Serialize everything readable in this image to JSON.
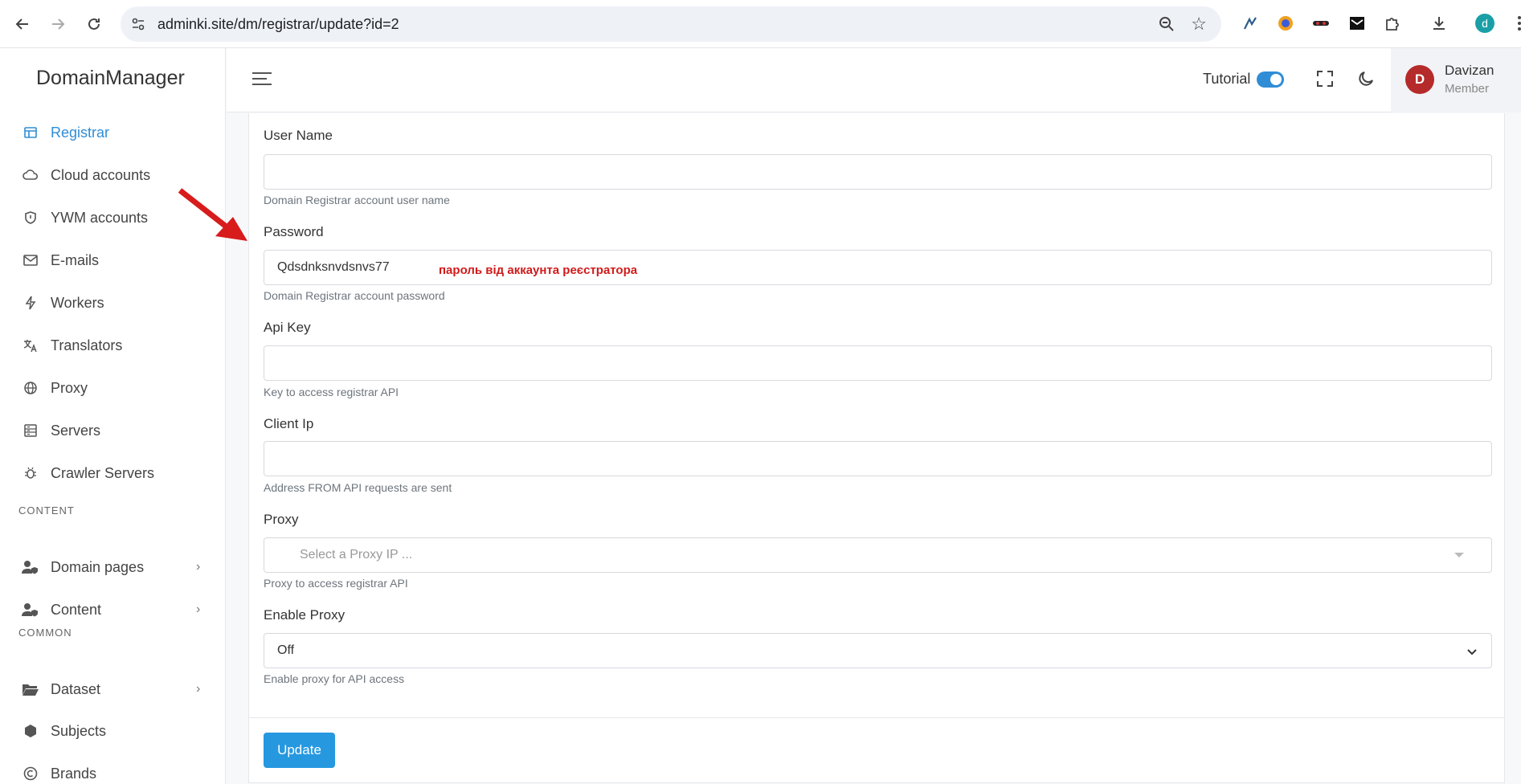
{
  "browser": {
    "url": "adminki.site/dm/registrar/update?id=2",
    "profile_initial": "d"
  },
  "sidebar": {
    "brand": "DomainManager",
    "items": [
      {
        "label": "Registrar",
        "icon": "window-icon"
      },
      {
        "label": "Cloud accounts",
        "icon": "cloud-icon"
      },
      {
        "label": "YWM accounts",
        "icon": "shield-icon"
      },
      {
        "label": "E-mails",
        "icon": "mail-icon"
      },
      {
        "label": "Workers",
        "icon": "bolt-icon"
      },
      {
        "label": "Translators",
        "icon": "translate-icon"
      },
      {
        "label": "Proxy",
        "icon": "globe-icon"
      },
      {
        "label": "Servers",
        "icon": "server-icon"
      },
      {
        "label": "Crawler Servers",
        "icon": "bug-icon"
      }
    ],
    "section_content": "CONTENT",
    "content_items": [
      {
        "label": "Domain pages",
        "icon": "user-shield-icon"
      },
      {
        "label": "Content",
        "icon": "user-shield-icon"
      }
    ],
    "section_common": "COMMON",
    "common_items": [
      {
        "label": "Dataset",
        "icon": "folder-icon"
      },
      {
        "label": "Subjects",
        "icon": "hexagon-icon"
      },
      {
        "label": "Brands",
        "icon": "copyright-icon"
      }
    ]
  },
  "header": {
    "tutorial_label": "Tutorial",
    "tutorial_on": true,
    "user_initial": "D",
    "user_name": "Davizan",
    "user_role": "Member"
  },
  "form": {
    "username": {
      "label": "User Name",
      "value": "",
      "help": "Domain Registrar account user name"
    },
    "password": {
      "label": "Password",
      "value": "Qdsdnksnvdsnvs77",
      "help": "Domain Registrar account password"
    },
    "apikey": {
      "label": "Api Key",
      "value": "",
      "help": "Key to access registrar API"
    },
    "clientip": {
      "label": "Client Ip",
      "value": "",
      "help": "Address FROM API requests are sent"
    },
    "proxy": {
      "label": "Proxy",
      "placeholder": "Select a Proxy IP ...",
      "help": "Proxy to access registrar API"
    },
    "enable_proxy": {
      "label": "Enable Proxy",
      "value": "Off",
      "help": "Enable proxy for API access"
    },
    "update_label": "Update"
  },
  "annotation": {
    "text": "пароль від аккаунта реєстратора",
    "color": "#d11a1a"
  },
  "colors": {
    "accent": "#2f8dd6",
    "button": "#2598e0",
    "avatar": "#b52a2a"
  }
}
